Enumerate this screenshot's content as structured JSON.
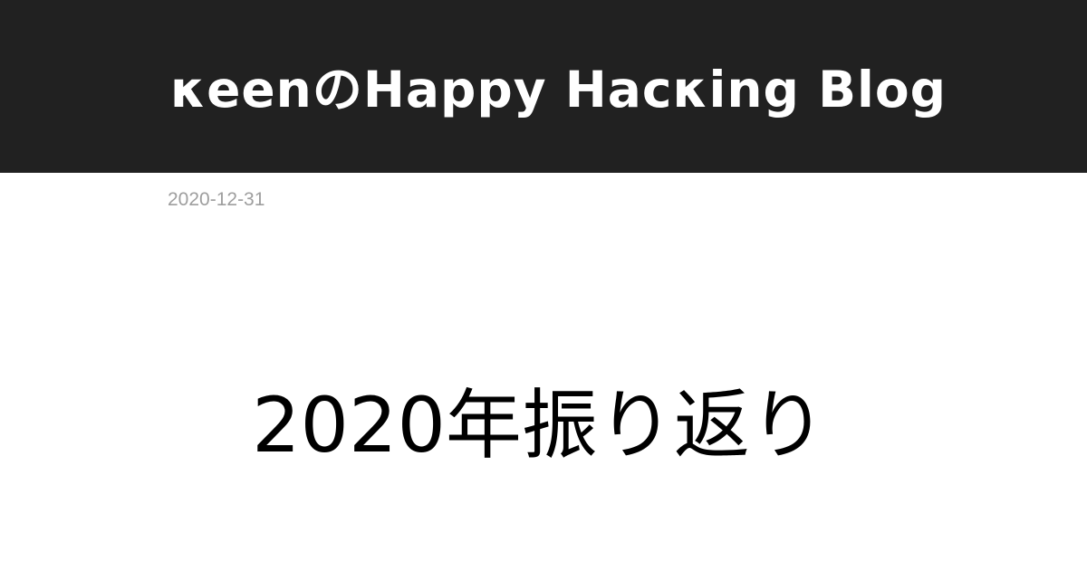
{
  "site": {
    "title": "κeenのHappy Hacκing Blog"
  },
  "post": {
    "date": "2020-12-31",
    "title": "2020年振り返り"
  },
  "colors": {
    "header_background": "#212121",
    "header_text": "#ffffff",
    "date_text": "#9e9e9e",
    "title_text": "#000000",
    "page_background": "#ffffff"
  }
}
